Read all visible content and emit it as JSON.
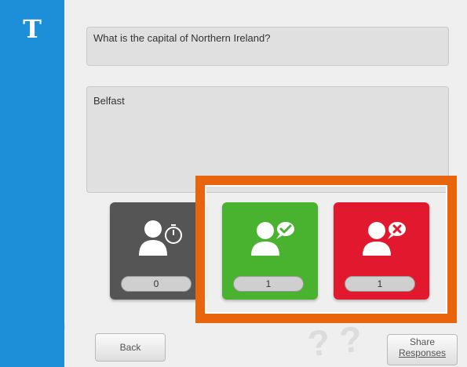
{
  "sidebar": {
    "letter": "T",
    "color": "#1d8fd8"
  },
  "question": {
    "text": "What is the capital of Northern Ireland?"
  },
  "answer": {
    "text": "Belfast"
  },
  "tiles": [
    {
      "name": "pending",
      "icon": "person-stopwatch-icon",
      "count": "0",
      "color": "#555555"
    },
    {
      "name": "correct",
      "icon": "person-check-icon",
      "count": "1",
      "color": "#49b330"
    },
    {
      "name": "incorrect",
      "icon": "person-x-icon",
      "count": "1",
      "color": "#e2192e"
    }
  ],
  "highlight": {
    "color": "#e8650e"
  },
  "buttons": {
    "back": "Back",
    "share_line1": "Share",
    "share_line2": "Responses"
  }
}
